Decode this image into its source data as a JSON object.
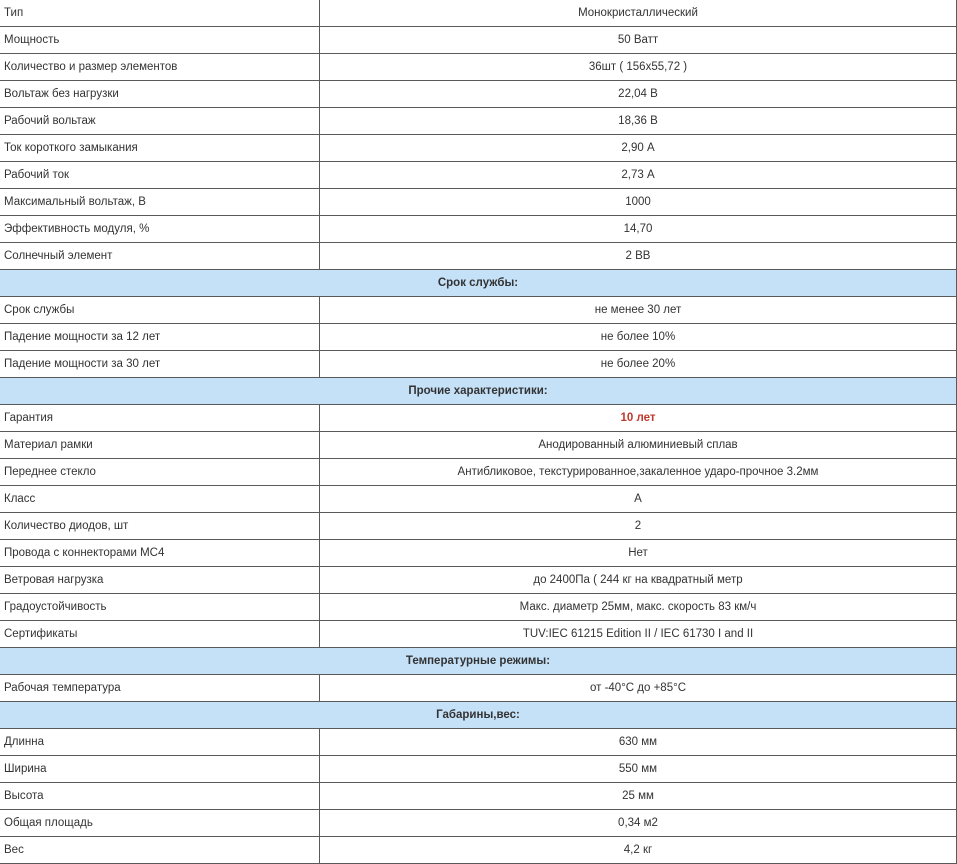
{
  "colors": {
    "section_bg": "#c5e1f8",
    "border": "#5a5a5a",
    "highlight_text": "#c0392b"
  },
  "main_rows": [
    {
      "label": "Тип",
      "value": "Монокристаллический"
    },
    {
      "label": "Мощность",
      "value": "50 Ватт"
    },
    {
      "label": "Количество и размер элементов",
      "value": "36шт ( 156x55,72 )"
    },
    {
      "label": "Вольтаж без нагрузки",
      "value": "22,04 В"
    },
    {
      "label": "Рабочий вольтаж",
      "value": "18,36 В"
    },
    {
      "label": "Ток короткого замыкания",
      "value": "2,90 А"
    },
    {
      "label": "Рабочий ток",
      "value": "2,73 А"
    },
    {
      "label": "Максимальный вольтаж, В",
      "value": "1000"
    },
    {
      "label": "Эффективность модуля, %",
      "value": "14,70"
    },
    {
      "label": "Солнечный элемент",
      "value": "2 BB"
    }
  ],
  "section_lifetime": {
    "title": "Срок службы:",
    "rows": [
      {
        "label": "Срок службы",
        "value": "не менее 30 лет"
      },
      {
        "label": "Падение мощности за 12 лет",
        "value": "не более 10%"
      },
      {
        "label": "Падение мощности за 30 лет",
        "value": "не более 20%"
      }
    ]
  },
  "section_other": {
    "title": "Прочие характеристики:",
    "rows": [
      {
        "label": "Гарантия",
        "value": "10 лет"
      },
      {
        "label": "Материал рамки",
        "value": "Анодированный алюминиевый сплав"
      },
      {
        "label": "Переднее стекло",
        "value": "Антибликовое, текстурированное,закаленное ударо-прочное 3.2мм"
      },
      {
        "label": "Класс",
        "value": "A"
      },
      {
        "label": "Количество диодов, шт",
        "value": "2"
      },
      {
        "label": "Провода с коннекторами MC4",
        "value": "Нет"
      },
      {
        "label": "Ветровая нагрузка",
        "value": "до 2400Па ( 244 кг на квадратный метр"
      },
      {
        "label": "Градоустойчивость",
        "value": "Макс. диаметр 25мм, макс. скорость 83 км/ч"
      },
      {
        "label": "Сертификаты",
        "value": "TUV:IEC 61215 Edition II / IEC 61730 I and II"
      }
    ]
  },
  "section_temperature": {
    "title": "Температурные режимы:",
    "rows": [
      {
        "label": "Рабочая температура",
        "value": "от -40°C до +85°C"
      }
    ]
  },
  "section_dimensions": {
    "title": "Габарины,вес:",
    "rows": [
      {
        "label": "Длинна",
        "value": "630 мм"
      },
      {
        "label": "Ширина",
        "value": "550 мм"
      },
      {
        "label": "Высота",
        "value": "25 мм"
      },
      {
        "label": "Общая площадь",
        "value": "0,34 м2"
      },
      {
        "label": "Вес",
        "value": "4,2 кг"
      }
    ]
  }
}
